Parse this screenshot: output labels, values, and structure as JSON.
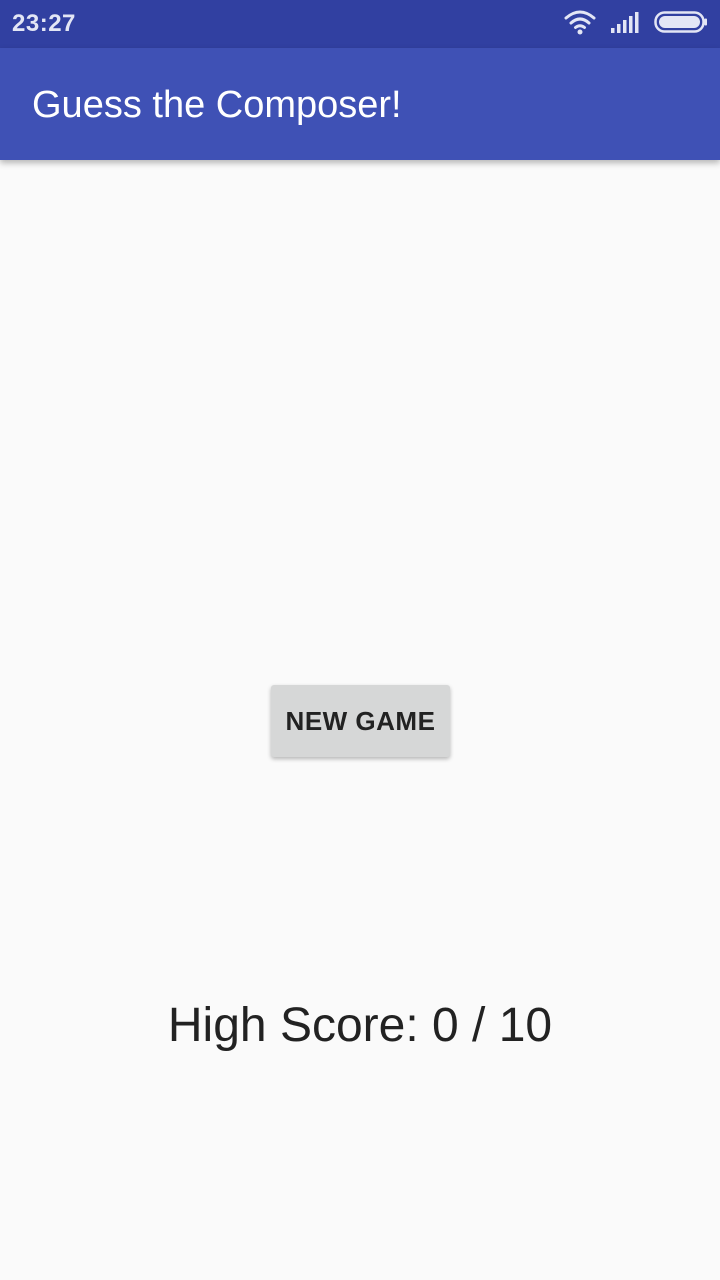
{
  "status_bar": {
    "time": "23:27",
    "icons": [
      "wifi-icon",
      "signal-icon",
      "battery-icon"
    ]
  },
  "app_bar": {
    "title": "Guess the Composer!"
  },
  "main": {
    "new_game_label": "NEW GAME",
    "high_score_text": "High Score: 0 / 10"
  },
  "colors": {
    "status_bar": "#3140a1",
    "app_bar": "#3f51b5",
    "background": "#fafafa",
    "button": "#d6d7d7",
    "text": "#222222"
  }
}
